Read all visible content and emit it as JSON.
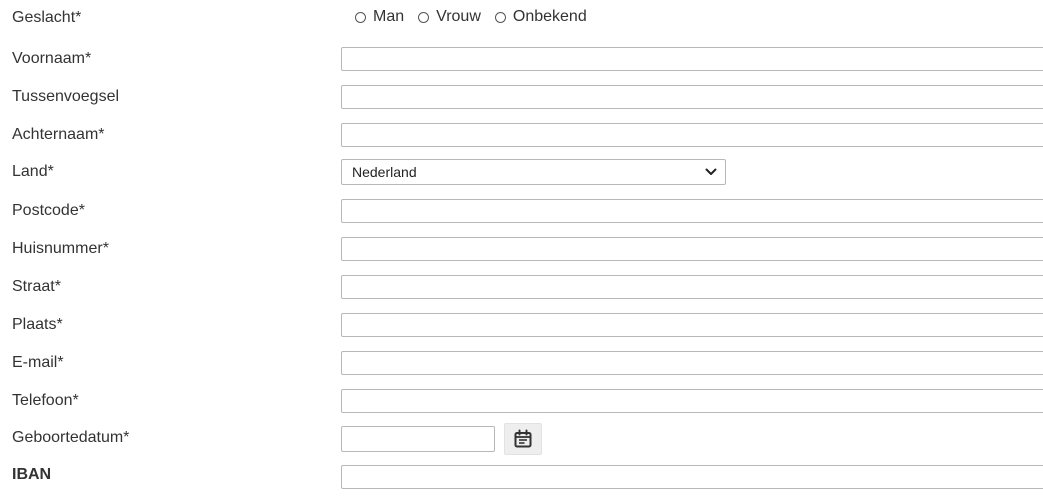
{
  "form": {
    "gender": {
      "label": "Geslacht*",
      "options": [
        "Man",
        "Vrouw",
        "Onbekend"
      ]
    },
    "first_name": {
      "label": "Voornaam*",
      "value": ""
    },
    "infix": {
      "label": "Tussenvoegsel",
      "value": ""
    },
    "last_name": {
      "label": "Achternaam*",
      "value": ""
    },
    "country": {
      "label": "Land*",
      "value": "Nederland"
    },
    "postal_code": {
      "label": "Postcode*",
      "value": ""
    },
    "house_number": {
      "label": "Huisnummer*",
      "value": ""
    },
    "street": {
      "label": "Straat*",
      "value": ""
    },
    "city": {
      "label": "Plaats*",
      "value": ""
    },
    "email": {
      "label": "E-mail*",
      "value": ""
    },
    "phone": {
      "label": "Telefoon*",
      "value": ""
    },
    "birth_date": {
      "label": "Geboortedatum*",
      "value": "",
      "button_icon": "calendar-icon"
    },
    "iban": {
      "label": "IBAN",
      "value": ""
    }
  },
  "colors": {
    "label_text": "#333333",
    "field_border": "#b8b8b8",
    "date_button_bg": "#eeeeee"
  }
}
